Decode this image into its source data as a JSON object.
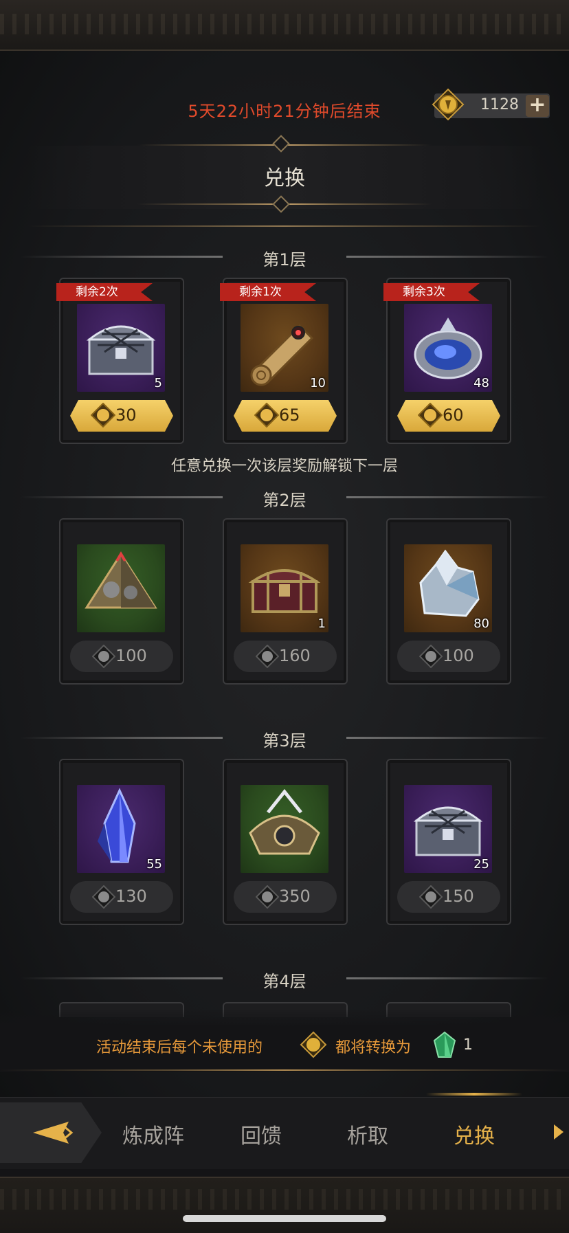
{
  "header": {
    "countdown": "5天22小时21分钟后结束",
    "currency_amount": "1128",
    "add_button": "+",
    "title": "兑换"
  },
  "tiers": [
    {
      "label": "第1层",
      "items": [
        {
          "tag": "剩余2次",
          "icon": "silver-chest-icon",
          "qty": "5",
          "price": "30",
          "bg": "purple"
        },
        {
          "tag": "剩余1次",
          "icon": "scroll-icon",
          "qty": "10",
          "price": "65",
          "bg": "gold"
        },
        {
          "tag": "剩余3次",
          "icon": "blue-orb-icon",
          "qty": "48",
          "price": "60",
          "bg": "purple"
        }
      ],
      "note": "任意兑换一次该层奖励解锁下一层"
    },
    {
      "label": "第2层",
      "items": [
        {
          "icon": "pyramid-icon",
          "qty": "",
          "price": "100",
          "bg": "green"
        },
        {
          "icon": "treasure-chest-icon",
          "qty": "1",
          "price": "160",
          "bg": "gold"
        },
        {
          "icon": "ice-crystal-icon",
          "qty": "80",
          "price": "100",
          "bg": "gold"
        }
      ]
    },
    {
      "label": "第3层",
      "items": [
        {
          "icon": "blue-crystal-icon",
          "qty": "55",
          "price": "130",
          "bg": "purple"
        },
        {
          "icon": "ornate-armor-icon",
          "qty": "",
          "price": "350",
          "bg": "green"
        },
        {
          "icon": "silver-chest-icon",
          "qty": "25",
          "price": "150",
          "bg": "purple"
        }
      ]
    },
    {
      "label": "第4层"
    }
  ],
  "conversion": {
    "text_before": "活动结束后每个未使用的",
    "text_after": "都将转换为",
    "qty": "1"
  },
  "nav": {
    "items": [
      "炼成阵",
      "回馈",
      "析取",
      "兑换"
    ],
    "active": "兑换"
  },
  "colors": {
    "accent_gold": "#e6b24a",
    "countdown_red": "#e04a2b",
    "tag_red": "#b8231c",
    "conversion_orange": "#e89a3a"
  }
}
